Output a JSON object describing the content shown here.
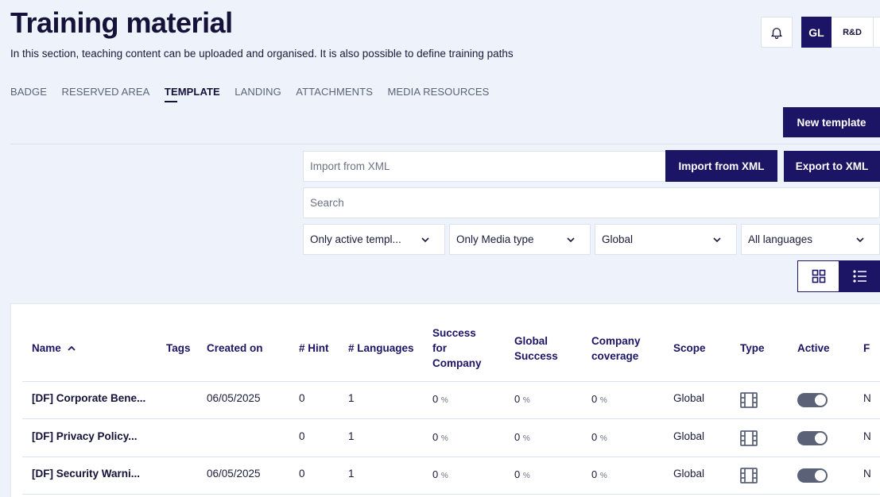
{
  "header": {
    "title": "Training material",
    "subtitle": "In this section, teaching content can be uploaded and organised. It is also possible to define training paths"
  },
  "topbar": {
    "notifications_icon": "bell-icon",
    "workspaces": [
      "GL",
      "R&D"
    ]
  },
  "tabs": [
    {
      "label": "BADGE",
      "active": false
    },
    {
      "label": "RESERVED AREA",
      "active": false
    },
    {
      "label": "TEMPLATE",
      "active": true
    },
    {
      "label": "LANDING",
      "active": false
    },
    {
      "label": "ATTACHMENTS",
      "active": false
    },
    {
      "label": "MEDIA RESOURCES",
      "active": false
    }
  ],
  "actions": {
    "new_template": "New template",
    "import_xml_placeholder": "Import from XML",
    "import_xml_button": "Import from XML",
    "export_xml_button": "Export to XML",
    "search_placeholder": "Search"
  },
  "filters": {
    "status": "Only active templ...",
    "media": "Only Media type",
    "scope": "Global",
    "language": "All languages"
  },
  "view_toggle": {
    "grid_icon": "grid-view-icon",
    "list_icon": "list-view-icon",
    "selected": "list"
  },
  "table": {
    "columns": {
      "name": "Name",
      "tags": "Tags",
      "created": "Created on",
      "hint": "# Hint",
      "languages": "# Languages",
      "success_company": "Success for Company",
      "global_success": "Global Success",
      "company_coverage": "Company coverage",
      "scope": "Scope",
      "type": "Type",
      "active": "Active",
      "extra": "F"
    },
    "sort": {
      "column": "name",
      "direction": "ascending"
    },
    "rows": [
      {
        "name": "[DF] Corporate Bene...",
        "created": "06/05/2025",
        "hint": "0",
        "languages": "1",
        "success_company": "0",
        "global_success": "0",
        "company_coverage": "0",
        "percent_sign": "%",
        "scope": "Global",
        "type": "video-icon",
        "active": true,
        "extra": "N"
      },
      {
        "name": "[DF] Privacy Policy...",
        "created": "",
        "hint": "0",
        "languages": "1",
        "success_company": "0",
        "global_success": "0",
        "company_coverage": "0",
        "percent_sign": "%",
        "scope": "Global",
        "type": "video-icon",
        "active": true,
        "extra": "N"
      },
      {
        "name": "[DF] Security Warni...",
        "created": "06/05/2025",
        "hint": "0",
        "languages": "1",
        "success_company": "0",
        "global_success": "0",
        "company_coverage": "0",
        "percent_sign": "%",
        "scope": "Global",
        "type": "video-icon",
        "active": true,
        "extra": "N"
      }
    ]
  }
}
